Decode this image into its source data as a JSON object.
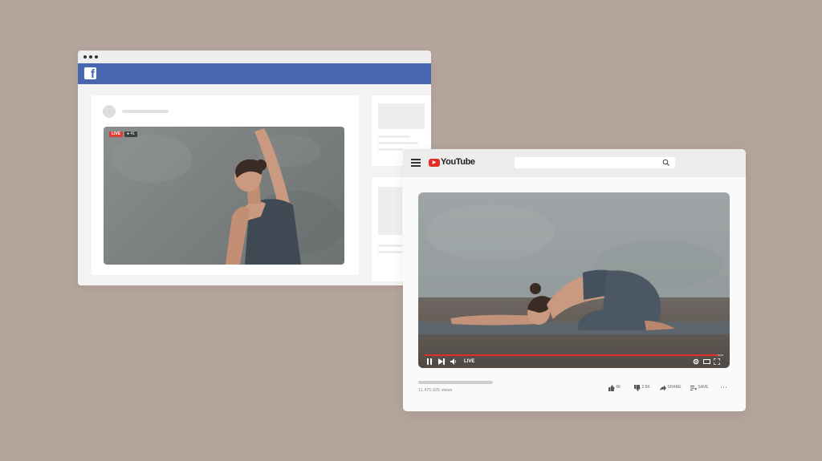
{
  "facebook": {
    "logo_letter": "f",
    "video": {
      "live_badge": "LIVE",
      "viewer_count": "41"
    }
  },
  "youtube": {
    "logo_text": "YouTube",
    "search": {
      "placeholder": "",
      "value": ""
    },
    "player": {
      "live_label": "LIVE",
      "progress_fraction": 0.98
    },
    "views": "11,470,925 views",
    "actions": {
      "like_count": "6K",
      "dislike_count": "2.5K",
      "share_label": "SHARE",
      "save_label": "SAVE"
    }
  },
  "colors": {
    "background": "#b5a49b",
    "facebook_blue": "#4767b1",
    "youtube_red": "#e52d27"
  }
}
